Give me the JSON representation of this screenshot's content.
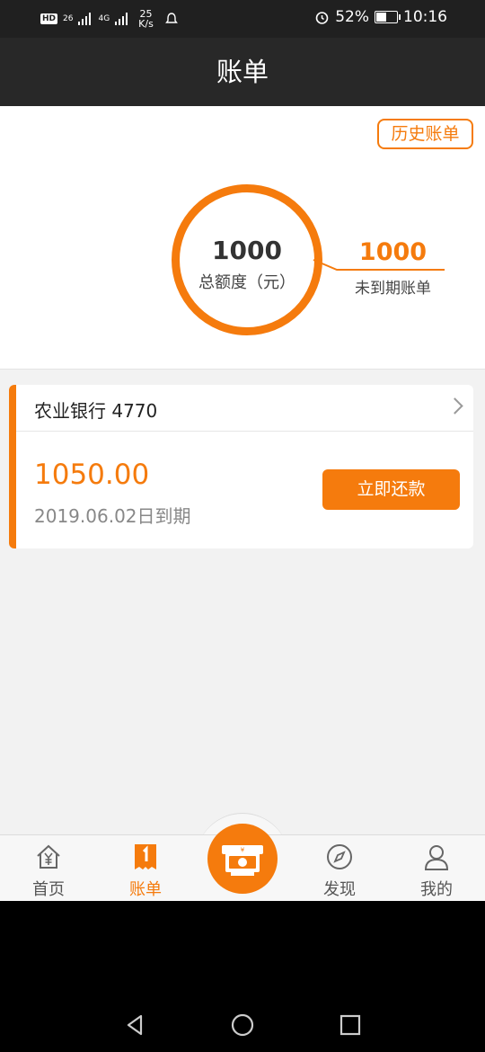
{
  "status_bar": {
    "hd": "HD",
    "network_1": "26",
    "network_2": "4G",
    "speed_value": "25",
    "speed_unit": "K/s",
    "battery_percent": "52%",
    "battery_level": 0.52,
    "time": "10:16",
    "icons": [
      "hd-icon",
      "signal-icon",
      "signal-icon",
      "notification-icon",
      "alarm-icon",
      "battery-icon"
    ]
  },
  "header": {
    "title": "账单"
  },
  "summary": {
    "history_button": "历史账单",
    "total_amount": "1000",
    "total_label": "总额度（元）",
    "unexpired_amount": "1000",
    "unexpired_label": "未到期账单"
  },
  "bill": {
    "bank_name": "农业银行 4770",
    "amount": "1050.00",
    "due": "2019.06.02日到期",
    "repay_button": "立即还款"
  },
  "tabs": [
    {
      "label": "首页",
      "icon": "home-yen-icon",
      "active": false
    },
    {
      "label": "账单",
      "icon": "bill-icon",
      "active": true
    },
    {
      "label": "",
      "icon": "cash-icon",
      "active": false
    },
    {
      "label": "发现",
      "icon": "compass-icon",
      "active": false
    },
    {
      "label": "我的",
      "icon": "user-icon",
      "active": false
    }
  ],
  "colors": {
    "accent": "#f57b0d",
    "header_bg": "#282828",
    "page_bg": "#f2f2f2"
  }
}
